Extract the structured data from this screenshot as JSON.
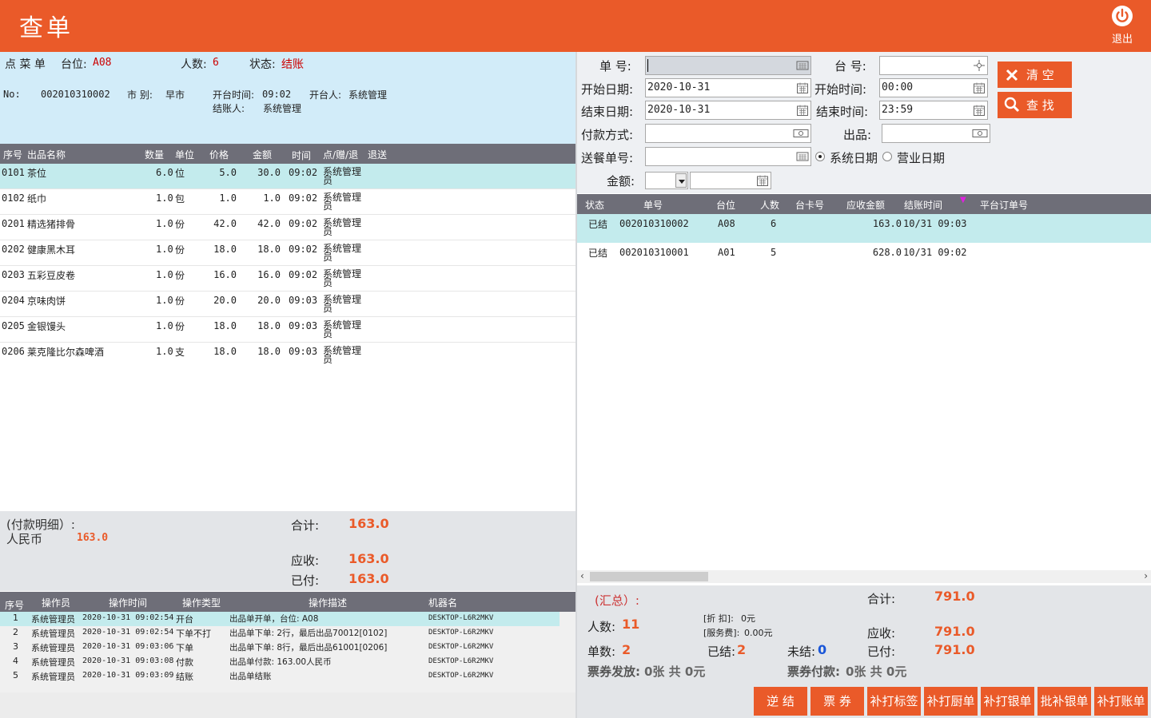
{
  "header": {
    "title": "查单",
    "exit_label": "退出"
  },
  "order": {
    "title_label": "点 菜 单",
    "table_label": "台位:",
    "table_value": "A08",
    "people_label": "人数:",
    "people_value": "6",
    "status_label": "状态:",
    "status_value": "结账",
    "no_label": "No:",
    "no_value": "002010310002",
    "market_label": "市  别:",
    "market_value": "早市",
    "open_time_label": "开台时间:",
    "open_time_value": "09:02",
    "opener_label": "开台人:",
    "opener_value": "系统管理",
    "checkout_label": "结账人:",
    "checkout_value": "系统管理"
  },
  "items_table": {
    "headers": [
      "序号",
      "出品名称",
      "数量",
      "单位",
      "价格",
      "金额",
      "时间",
      "点/赠/退",
      "退送"
    ],
    "rows": [
      {
        "code": "0101",
        "name": "茶位",
        "qty": "6.0",
        "unit": "位",
        "price": "5.0",
        "amount": "30.0",
        "time": "09:02",
        "op": "系统管理员"
      },
      {
        "code": "0102",
        "name": "纸巾",
        "qty": "1.0",
        "unit": "包",
        "price": "1.0",
        "amount": "1.0",
        "time": "09:02",
        "op": "系统管理员"
      },
      {
        "code": "0201",
        "name": "精选猪排骨",
        "qty": "1.0",
        "unit": "份",
        "price": "42.0",
        "amount": "42.0",
        "time": "09:02",
        "op": "系统管理员"
      },
      {
        "code": "0202",
        "name": "健康黑木耳",
        "qty": "1.0",
        "unit": "份",
        "price": "18.0",
        "amount": "18.0",
        "time": "09:02",
        "op": "系统管理员"
      },
      {
        "code": "0203",
        "name": "五彩豆皮卷",
        "qty": "1.0",
        "unit": "份",
        "price": "16.0",
        "amount": "16.0",
        "time": "09:02",
        "op": "系统管理员"
      },
      {
        "code": "0204",
        "name": "京味肉饼",
        "qty": "1.0",
        "unit": "份",
        "price": "20.0",
        "amount": "20.0",
        "time": "09:03",
        "op": "系统管理员"
      },
      {
        "code": "0205",
        "name": "金银馒头",
        "qty": "1.0",
        "unit": "份",
        "price": "18.0",
        "amount": "18.0",
        "time": "09:03",
        "op": "系统管理员"
      },
      {
        "code": "0206",
        "name": "莱克隆比尔森啤酒",
        "qty": "1.0",
        "unit": "支",
        "price": "18.0",
        "amount": "18.0",
        "time": "09:03",
        "op": "系统管理员"
      }
    ]
  },
  "payment": {
    "detail_label": "(付款明细）:",
    "rmb_label": "人民币",
    "rmb_value": "163.0",
    "total_label": "合计:",
    "total_value": "163.0",
    "receivable_label": "应收:",
    "receivable_value": "163.0",
    "paid_label": "已付:",
    "paid_value": "163.0"
  },
  "log_table": {
    "headers": [
      "序号",
      "操作员",
      "操作时间",
      "操作类型",
      "操作描述",
      "机器名"
    ],
    "rows": [
      {
        "no": "1",
        "operator": "系统管理员",
        "time": "2020-10-31  09:02:54",
        "type": "开台",
        "desc": "出品单开单，台位: A08",
        "machine": "DESKTOP-L6R2MKV"
      },
      {
        "no": "2",
        "operator": "系统管理员",
        "time": "2020-10-31  09:02:54",
        "type": "下单不打",
        "desc": "出品单下单: 2行，最后出品70012[0102]",
        "machine": "DESKTOP-L6R2MKV"
      },
      {
        "no": "3",
        "operator": "系统管理员",
        "time": "2020-10-31  09:03:06",
        "type": "下单",
        "desc": "出品单下单: 8行，最后出品61001[0206]",
        "machine": "DESKTOP-L6R2MKV"
      },
      {
        "no": "4",
        "operator": "系统管理员",
        "time": "2020-10-31  09:03:08",
        "type": "付款",
        "desc": "出品单付款: 163.00人民币",
        "machine": "DESKTOP-L6R2MKV"
      },
      {
        "no": "5",
        "operator": "系统管理员",
        "time": "2020-10-31  09:03:09",
        "type": "结账",
        "desc": "出品单结账",
        "machine": "DESKTOP-L6R2MKV"
      }
    ]
  },
  "search": {
    "order_no_label": "单  号:",
    "order_no_value": "",
    "table_label": "台  号:",
    "table_value": "",
    "start_date_label": "开始日期:",
    "start_date_value": "2020-10-31",
    "start_time_label": "开始时间:",
    "start_time_value": "00:00",
    "end_date_label": "结束日期:",
    "end_date_value": "2020-10-31",
    "end_time_label": "结束时间:",
    "end_time_value": "23:59",
    "pay_method_label": "付款方式:",
    "pay_method_value": "",
    "product_label": "出品:",
    "product_value": "",
    "delivery_label": "送餐单号:",
    "delivery_value": "",
    "radio_system": "系统日期",
    "radio_business": "营业日期",
    "amount_label": "金额:",
    "clear_label": "清  空",
    "search_label": "查  找"
  },
  "orders_table": {
    "headers": [
      "状态",
      "单号",
      "台位",
      "人数",
      "台卡号",
      "应收金额",
      "结账时间",
      "平台订单号"
    ],
    "rows": [
      {
        "status": "已结",
        "no": "002010310002",
        "table": "A08",
        "people": "6",
        "card": "",
        "amount": "163.0",
        "time": "10/31  09:03",
        "platform": ""
      },
      {
        "status": "已结",
        "no": "002010310001",
        "table": "A01",
        "people": "5",
        "card": "",
        "amount": "628.0",
        "time": "10/31  09:02",
        "platform": ""
      }
    ]
  },
  "summary": {
    "title": "(汇总）:",
    "total_label": "合计:",
    "total_value": "791.0",
    "people_label": "人数:",
    "people_value": "11",
    "discount_label": "[折  扣]:",
    "discount_value": "0元",
    "service_label": "[服务费]:",
    "service_value": "0.00元",
    "receivable_label": "应收:",
    "receivable_value": "791.0",
    "orders_label": "单数:",
    "orders_value": "2",
    "settled_label": "已结:",
    "settled_value": "2",
    "unsettled_label": "未结:",
    "unsettled_value": "0",
    "paid_label": "已付:",
    "paid_value": "791.0",
    "voucher_issue_label": "票券发放:",
    "voucher_issue_value": "0张 共 0元",
    "voucher_pay_label": "票券付款:",
    "voucher_pay_value": "0张 共 0元"
  },
  "bottom_buttons": [
    "逆  结",
    "票  券",
    "补打标签",
    "补打厨单",
    "补打银单",
    "批补银单",
    "补打账单"
  ],
  "colors": {
    "brand": "#ea5a29",
    "header_bg": "#6e6e78",
    "selected_row": "#c3ebed",
    "info_bg": "#d2ecf9"
  }
}
